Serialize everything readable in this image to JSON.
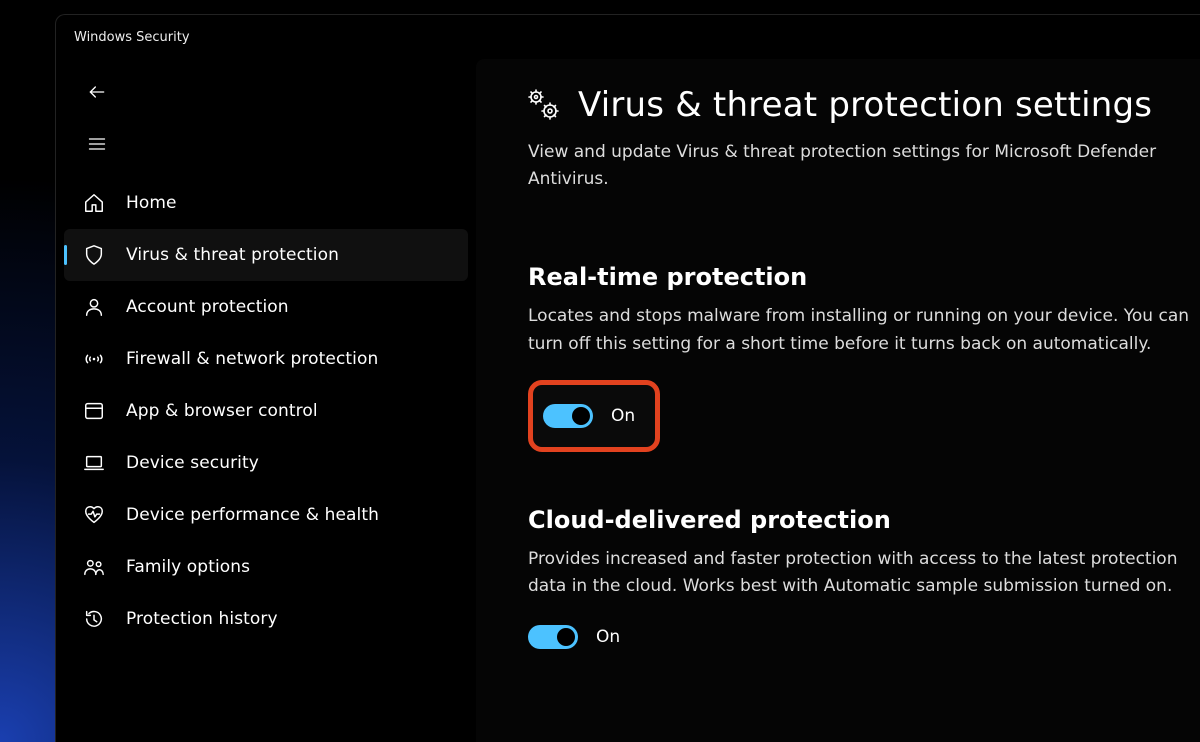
{
  "window": {
    "title": "Windows Security"
  },
  "sidebar": {
    "items": [
      {
        "id": "home",
        "label": "Home",
        "selected": false
      },
      {
        "id": "virus",
        "label": "Virus & threat protection",
        "selected": true
      },
      {
        "id": "account",
        "label": "Account protection",
        "selected": false
      },
      {
        "id": "firewall",
        "label": "Firewall & network protection",
        "selected": false
      },
      {
        "id": "app",
        "label": "App & browser control",
        "selected": false
      },
      {
        "id": "device",
        "label": "Device security",
        "selected": false
      },
      {
        "id": "performance",
        "label": "Device performance & health",
        "selected": false
      },
      {
        "id": "family",
        "label": "Family options",
        "selected": false
      },
      {
        "id": "history",
        "label": "Protection history",
        "selected": false
      }
    ]
  },
  "page": {
    "title": "Virus & threat protection settings",
    "subtitle": "View and update Virus & threat protection settings for Microsoft Defender Antivirus."
  },
  "sections": {
    "realtime": {
      "title": "Real-time protection",
      "desc": "Locates and stops malware from installing or running on your device. You can turn off this setting for a short time before it turns back on automatically.",
      "state_label": "On",
      "state": true,
      "highlighted": true
    },
    "cloud": {
      "title": "Cloud-delivered protection",
      "desc": "Provides increased and faster protection with access to the latest protection data in the cloud. Works best with Automatic sample submission turned on.",
      "state_label": "On",
      "state": true,
      "highlighted": false
    }
  },
  "colors": {
    "accent": "#4cc2ff",
    "highlight": "#e2421f"
  }
}
